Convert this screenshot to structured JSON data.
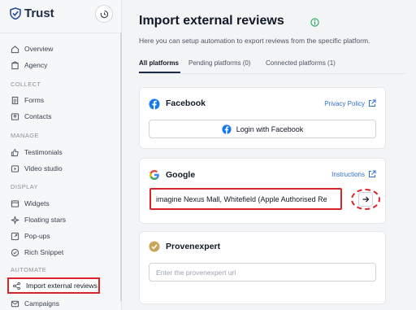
{
  "app": {
    "name": "Trust"
  },
  "sidebar": {
    "items_top": [
      {
        "label": "Overview",
        "icon": "home-icon"
      },
      {
        "label": "Agency",
        "icon": "building-icon"
      }
    ],
    "sections": [
      {
        "title": "COLLECT",
        "items": [
          {
            "label": "Forms",
            "icon": "form-icon"
          },
          {
            "label": "Contacts",
            "icon": "contacts-icon"
          }
        ]
      },
      {
        "title": "MANAGE",
        "items": [
          {
            "label": "Testimonials",
            "icon": "thumbs-up-icon"
          },
          {
            "label": "Video studio",
            "icon": "video-icon"
          }
        ]
      },
      {
        "title": "DISPLAY",
        "items": [
          {
            "label": "Widgets",
            "icon": "widgets-icon"
          },
          {
            "label": "Floating stars",
            "icon": "sparkle-icon"
          },
          {
            "label": "Pop-ups",
            "icon": "popup-icon"
          },
          {
            "label": "Rich Snippet",
            "icon": "snippet-icon"
          }
        ]
      },
      {
        "title": "AUTOMATE",
        "items": [
          {
            "label": "Import external reviews",
            "icon": "share-icon",
            "active": true
          },
          {
            "label": "Campaigns",
            "icon": "mail-icon"
          }
        ]
      }
    ]
  },
  "main": {
    "title": "Import external reviews",
    "subtitle": "Here you can setup automation to export reviews from the specific platform.",
    "tabs": [
      {
        "label": "All platforms",
        "active": true
      },
      {
        "label": "Pending platforms (0)"
      },
      {
        "label": "Connected platforms (1)"
      }
    ],
    "facebook": {
      "title": "Facebook",
      "link": "Privacy Policy",
      "button": "Login with Facebook"
    },
    "google": {
      "title": "Google",
      "link": "Instructions",
      "input_value": "imagine Nexus Mall, Whitefield (Apple Authorised Re"
    },
    "provenexpert": {
      "title": "Provenexpert",
      "placeholder": "Enter the provenexpert url"
    }
  },
  "colors": {
    "accent": "#2f6fd1",
    "highlight": "#d9242a",
    "facebook": "#1877f2",
    "provenexpert": "#c9a45c"
  }
}
